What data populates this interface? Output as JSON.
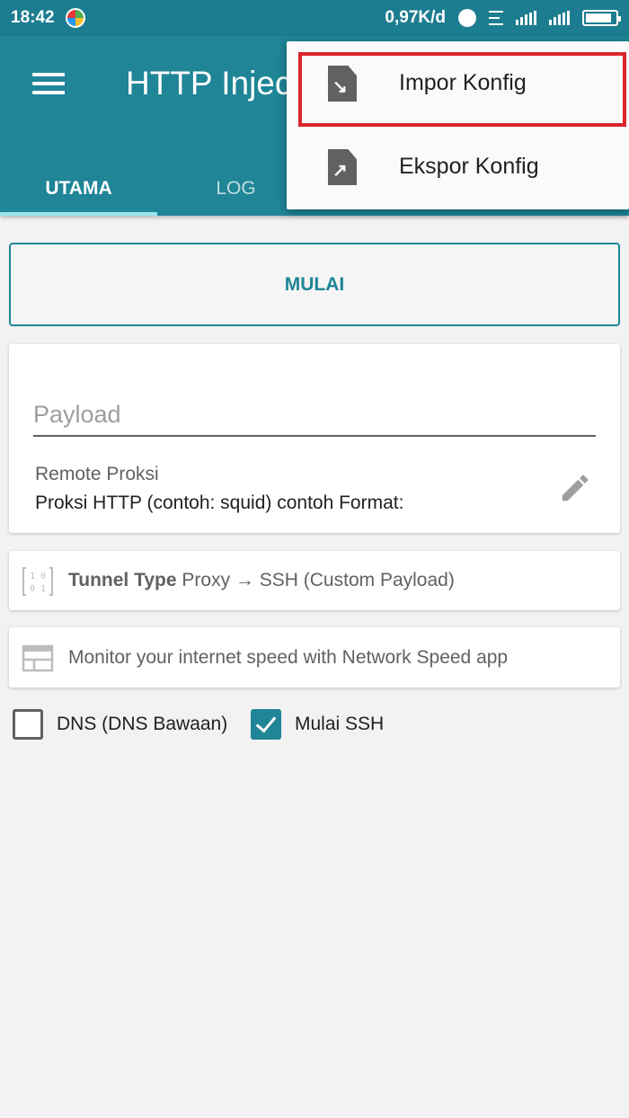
{
  "status_bar": {
    "time": "18:42",
    "network_speed": "0,97K/d",
    "icons": [
      "maps-icon",
      "alarm-icon",
      "notification-list-icon",
      "signal-icon",
      "signal-icon",
      "battery-icon"
    ]
  },
  "app_bar": {
    "title": "HTTP Injec",
    "tabs": [
      {
        "label": "UTAMA",
        "selected": true
      },
      {
        "label": "LOG",
        "selected": false
      }
    ]
  },
  "overflow_menu": {
    "items": [
      {
        "label": "Impor Konfig",
        "icon": "file-import-icon",
        "highlighted": true
      },
      {
        "label": "Ekspor Konfig",
        "icon": "file-export-icon",
        "highlighted": false
      }
    ]
  },
  "main": {
    "start_button_label": "MULAI",
    "payload_placeholder": "Payload",
    "remote_proxy_label": "Remote Proksi",
    "remote_proxy_value": "Proksi HTTP (contoh: squid) contoh Format:",
    "tunnel_type_label": "Tunnel Type",
    "tunnel_type_value": "Proxy → SSH (Custom Payload)",
    "speed_promo": "Monitor your internet speed with Network Speed app",
    "checkboxes": [
      {
        "label": "DNS (DNS Bawaan)",
        "checked": false
      },
      {
        "label": "Mulai SSH",
        "checked": true
      }
    ]
  },
  "colors": {
    "primary": "#1f8597",
    "status_bar": "#1d7d90",
    "highlight_outline": "#d9262c",
    "background": "#f2f2f2"
  }
}
